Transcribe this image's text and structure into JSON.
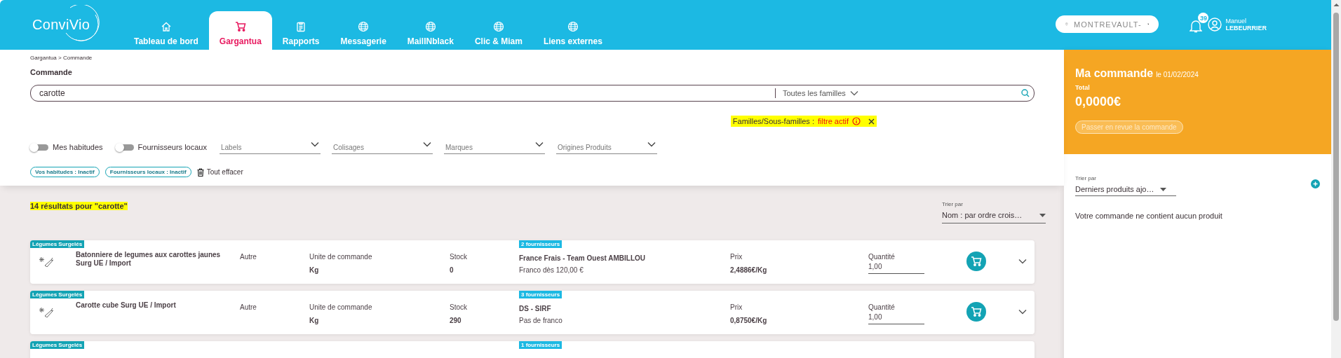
{
  "header": {
    "logo": "ConviVio",
    "tabs": [
      {
        "label": "Tableau de bord",
        "selected": false
      },
      {
        "label": "Gargantua",
        "selected": true
      },
      {
        "label": "Rapports",
        "selected": false
      },
      {
        "label": "Messagerie",
        "selected": false
      },
      {
        "label": "MailINblack",
        "selected": false
      },
      {
        "label": "Clic & Miam",
        "selected": false
      },
      {
        "label": "Liens externes",
        "selected": false
      }
    ],
    "location": "MONTREVAULT-",
    "notifications": "39",
    "user": {
      "first_name": "Manuel",
      "last_name": "LEBEURRIER"
    }
  },
  "breadcrumb": "Gargantua > Commande",
  "page_title": "Commande",
  "search": {
    "value": "carotte",
    "family": "Toutes les familles"
  },
  "filter_notice": {
    "label": "Familles/Sous-familles :",
    "status": "filtre actif"
  },
  "toggles": [
    {
      "label": "Mes habitudes",
      "on": false
    },
    {
      "label": "Fournisseurs locaux",
      "on": false
    }
  ],
  "dropdowns": [
    {
      "placeholder": "Labels"
    },
    {
      "placeholder": "Colisages"
    },
    {
      "placeholder": "Marques"
    },
    {
      "placeholder": "Origines Produits"
    }
  ],
  "chips": [
    "Vos habitudes : Inactif",
    "Fournisseurs locaux : Inactif"
  ],
  "clear_all": "Tout effacer",
  "results": {
    "count": "14 résultats pour \"carotte\"",
    "sort": {
      "label": "Trier par",
      "value": "Nom : par ordre crois…"
    },
    "rows": [
      {
        "category": "Légumes Surgelés",
        "name": "Batonniere de legumes aux carottes jaunes Surg UE / Import",
        "origin": "Autre",
        "unit_label": "Unite de commande",
        "unit": "Kg",
        "stock_label": "Stock",
        "stock": "0",
        "supplier_count": "2 fournisseurs",
        "supplier": "France Frais - Team Ouest AMBILLOU",
        "franco": "Franco dès 120,00 €",
        "price_label": "Prix",
        "price": "2,4886€/Kg",
        "quantity_label": "Quantité",
        "quantity": "1,00"
      },
      {
        "category": "Légumes Surgelés",
        "name": "Carotte cube Surg UE / Import",
        "origin": "Autre",
        "unit_label": "Unite de commande",
        "unit": "Kg",
        "stock_label": "Stock",
        "stock": "290",
        "supplier_count": "3 fournisseurs",
        "supplier": "DS - SIRF",
        "franco": "Pas de franco",
        "price_label": "Prix",
        "price": "0,8750€/Kg",
        "quantity_label": "Quantité",
        "quantity": "1,00"
      },
      {
        "category": "Légumes Surgelés",
        "supplier_count": "1 fournisseurs"
      }
    ]
  },
  "order": {
    "title": "Ma commande",
    "date": "le 01/02/2024",
    "total_label": "Total",
    "total": "0,0000€",
    "review_button": {
      "label": "Passer en revue la commande",
      "disabled": true
    },
    "sort": {
      "label": "Trier par",
      "value": "Derniers produits ajo…"
    },
    "empty_message": "Votre commande ne contient aucun produit"
  }
}
